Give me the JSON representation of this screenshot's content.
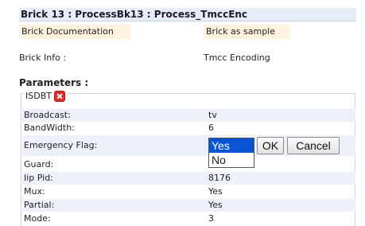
{
  "title": "Brick 13 : ProcessBk13 : Process_TmccEnc",
  "links": {
    "documentation": "Brick Documentation",
    "sample": "Brick as sample"
  },
  "info": {
    "label": "Brick Info :",
    "value": "Tmcc Encoding"
  },
  "parameters_label": "Parameters :",
  "group": {
    "legend": "ISDBT",
    "remove_icon": "close-icon"
  },
  "rows": [
    {
      "label": "Broadcast:",
      "value": "tv"
    },
    {
      "label": "BandWidth:",
      "value": "6"
    },
    {
      "label": "Emergency Flag:",
      "value": ""
    },
    {
      "label": "Guard:",
      "value": ""
    },
    {
      "label": "Iip Pid:",
      "value": "8176"
    },
    {
      "label": "Mux:",
      "value": "Yes"
    },
    {
      "label": "Partial:",
      "value": "Yes"
    },
    {
      "label": "Mode:",
      "value": "3"
    }
  ],
  "editor": {
    "options": [
      "Yes",
      "No"
    ],
    "selected": "Yes",
    "ok_label": "OK",
    "cancel_label": "Cancel"
  },
  "colors": {
    "row_alt": "#edf2fa",
    "link_bg": "#fdf3df",
    "select_highlight": "#0a55d6",
    "remove_icon": "#d9302b"
  }
}
